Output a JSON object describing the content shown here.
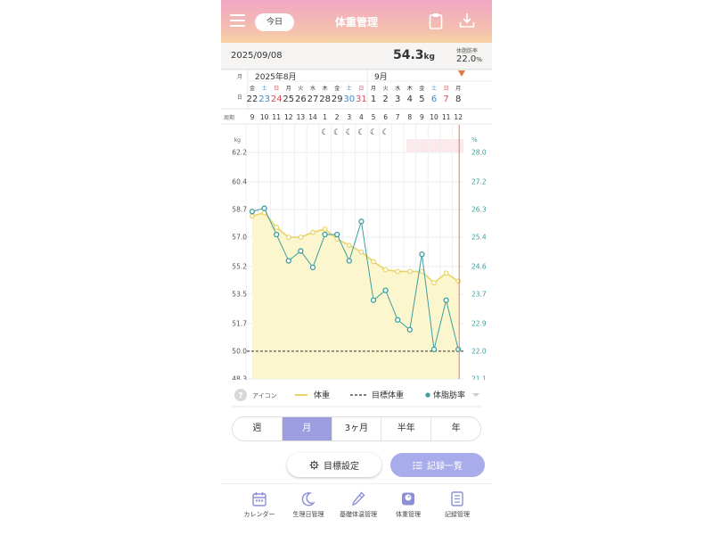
{
  "header": {
    "today_label": "今日",
    "title": "体重管理",
    "colors": {
      "gradient_top": "#f0a7c4",
      "gradient_bottom": "#f6d2a4"
    },
    "icons": [
      "menu-icon",
      "clipboard-icon",
      "download-icon"
    ]
  },
  "summary": {
    "date": "2025/09/08",
    "weight": "54.3",
    "weight_unit": "kg",
    "fat_label": "体脂肪率",
    "fat_value": "22.0",
    "fat_unit": "%"
  },
  "calendar": {
    "month_label": "月",
    "day_label": "日",
    "week_label": "周期",
    "month_aug": "2025年8月",
    "month_sep": "9月",
    "weekdays": [
      "金",
      "土",
      "日",
      "月",
      "火",
      "水",
      "木",
      "金",
      "土",
      "日",
      "月",
      "火",
      "水",
      "木",
      "金",
      "土",
      "日",
      "月"
    ],
    "days": [
      "22",
      "23",
      "24",
      "25",
      "26",
      "27",
      "28",
      "29",
      "30",
      "31",
      "1",
      "2",
      "3",
      "4",
      "5",
      "6",
      "7",
      "8"
    ],
    "cycle": [
      "9",
      "10",
      "11",
      "12",
      "13",
      "14",
      "1",
      "2",
      "3",
      "4",
      "5",
      "6",
      "7",
      "8",
      "9",
      "10",
      "11",
      "12"
    ]
  },
  "chart_data": {
    "type": "line",
    "x": [
      "8/22",
      "8/23",
      "8/24",
      "8/25",
      "8/26",
      "8/27",
      "8/28",
      "8/29",
      "8/30",
      "8/31",
      "9/1",
      "9/2",
      "9/3",
      "9/4",
      "9/5",
      "9/6",
      "9/7",
      "9/8"
    ],
    "left_axis": {
      "unit": "kg",
      "ticks": [
        "62.2",
        "60.4",
        "58.7",
        "57.0",
        "55.2",
        "53.5",
        "51.7",
        "50.0",
        "48.3"
      ],
      "range": [
        48.3,
        62.2
      ]
    },
    "right_axis": {
      "unit": "%",
      "ticks": [
        "28.0",
        "27.2",
        "26.3",
        "25.4",
        "24.6",
        "23.7",
        "22.9",
        "22.0",
        "21.1"
      ],
      "range": [
        21.1,
        28.0
      ]
    },
    "series": [
      {
        "name": "体重",
        "color": "#e8d469",
        "axis": "left",
        "values": [
          58.3,
          58.5,
          57.6,
          57.0,
          57.0,
          57.3,
          57.5,
          56.9,
          56.5,
          56.1,
          55.5,
          55.0,
          54.9,
          54.9,
          54.9,
          54.2,
          54.8,
          54.3
        ]
      },
      {
        "name": "体脂肪率",
        "color": "#3d9e9e",
        "axis": "right",
        "values": [
          26.2,
          26.3,
          25.5,
          24.7,
          25.0,
          24.5,
          25.5,
          25.5,
          24.7,
          25.9,
          23.5,
          23.8,
          22.9,
          22.6,
          24.9,
          22.0,
          23.5,
          22.0
        ]
      },
      {
        "name": "目標体重",
        "color": "#333333",
        "axis": "left",
        "style": "dashed",
        "values": [
          50.0
        ]
      }
    ],
    "moons": [
      "☾",
      "☾",
      "☾",
      "☾",
      "☾",
      "☾"
    ],
    "grid": true
  },
  "legend": {
    "help_icon": "?",
    "icon_label": "アイコン",
    "weight_label": "体重",
    "target_label": "目標体重",
    "fat_label": "体脂肪率"
  },
  "range_tabs": [
    "週",
    "月",
    "3ヶ月",
    "半年",
    "年"
  ],
  "actions": {
    "goal_label": "目標設定",
    "records_label": "記録一覧"
  },
  "nav": [
    {
      "label": "カレンダー",
      "icon": "calendar-icon"
    },
    {
      "label": "生理日管理",
      "icon": "moon-icon"
    },
    {
      "label": "基礎体温管理",
      "icon": "thermometer-icon"
    },
    {
      "label": "体重管理",
      "icon": "scale-icon"
    },
    {
      "label": "記録管理",
      "icon": "notebook-icon"
    }
  ]
}
